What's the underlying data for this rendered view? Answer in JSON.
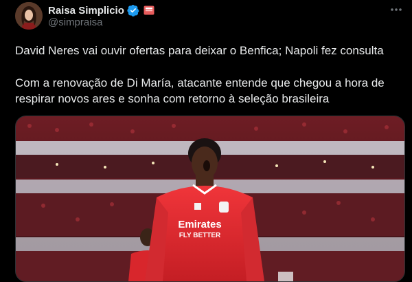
{
  "author": {
    "display_name": "Raisa Simplicio",
    "handle": "@simpraisa"
  },
  "icons": {
    "verified": "verified-badge-icon",
    "affiliate": "affiliate-badge-icon",
    "more": "more-options-icon"
  },
  "tweet": {
    "headline": "David Neres vai ouvir ofertas para deixar o Benfica; Napoli fez consulta",
    "body": "Com a renovação de Di María, atacante entende que chegou a hora de respirar novos ares e sonha com retorno à seleção brasileira"
  },
  "media": {
    "jersey_text_line1": "Emirates",
    "jersey_text_line2": "FLY BETTER"
  },
  "colors": {
    "background": "#000000",
    "text": "#e7e9ea",
    "secondary_text": "#71767b",
    "verified_blue": "#1d9bf0",
    "benfica_red": "#e3262c"
  }
}
